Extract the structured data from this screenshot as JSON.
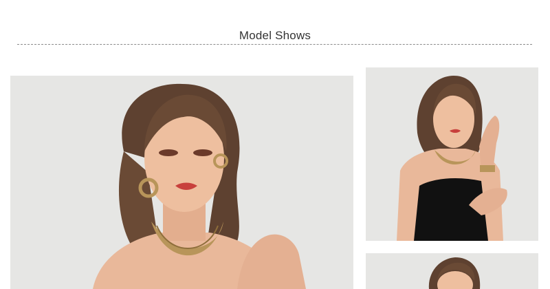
{
  "section": {
    "title": "Model Shows"
  },
  "photos": [
    {
      "name": "model-closeup-portrait",
      "depicts": "model-wearing-gold-collar-necklace-and-hoop-earrings"
    },
    {
      "name": "model-black-top-portrait",
      "depicts": "model-wearing-gold-collar-necklace-and-cuff-bracelet"
    },
    {
      "name": "model-portrait-cropped",
      "depicts": "model-portrait-partially-visible"
    }
  ],
  "colors": {
    "background": "#ffffff",
    "photo_backdrop": "#e5e5e3",
    "hair": "#6a4a35",
    "skin": "#e9b89a",
    "gold": "#b8955a",
    "black_top": "#111111",
    "lips": "#c8403c",
    "divider": "#8a8a8a",
    "title_text": "#333333"
  }
}
